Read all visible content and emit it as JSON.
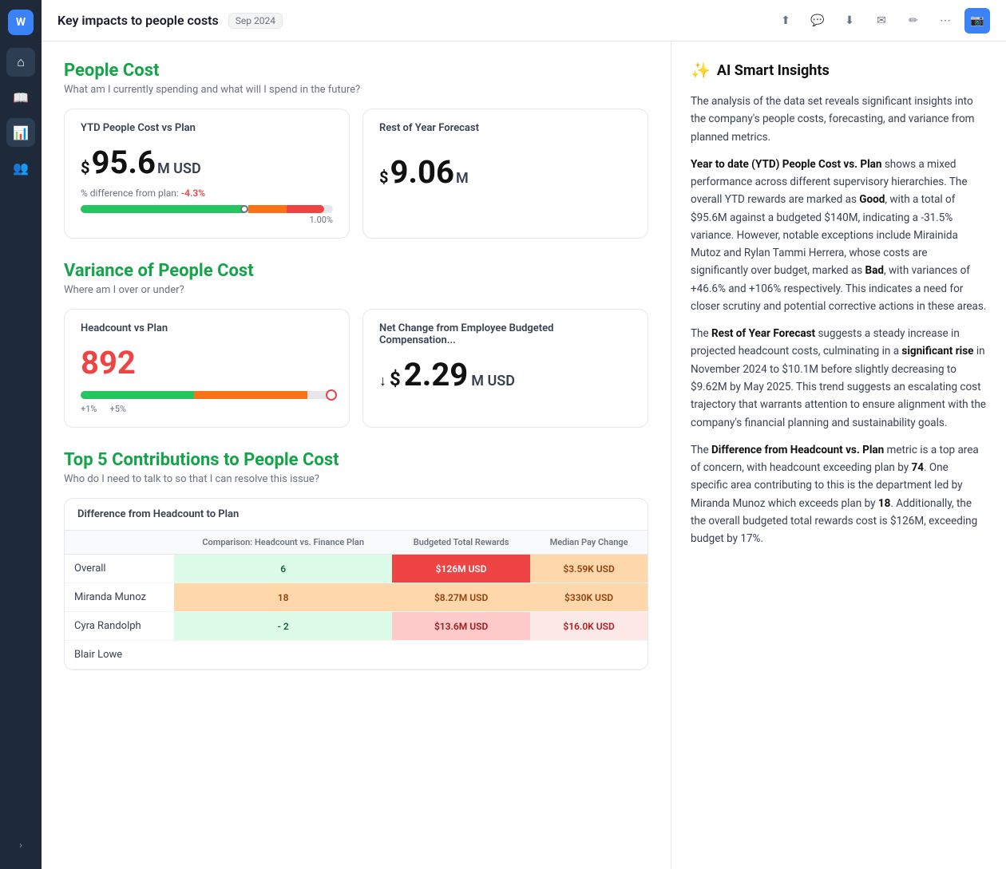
{
  "sidebar": {
    "logo": "W",
    "items": [
      {
        "icon": "⌂",
        "label": "Home",
        "active": false
      },
      {
        "icon": "📖",
        "label": "Library",
        "active": false
      },
      {
        "icon": "📊",
        "label": "Analytics",
        "active": true
      },
      {
        "icon": "👥",
        "label": "People",
        "active": false
      }
    ],
    "collapse_label": "‹"
  },
  "topbar": {
    "title": "Key impacts to people costs",
    "badge": "Sep 2024",
    "actions": [
      {
        "icon": "⬆",
        "name": "upload-icon"
      },
      {
        "icon": "💬",
        "name": "comment-icon"
      },
      {
        "icon": "⬇",
        "name": "download-icon"
      },
      {
        "icon": "✉",
        "name": "email-icon"
      },
      {
        "icon": "✏",
        "name": "edit-icon"
      },
      {
        "icon": "⋯",
        "name": "more-icon"
      },
      {
        "icon": "📷",
        "name": "camera-icon",
        "active": true
      }
    ]
  },
  "people_cost": {
    "title": "People Cost",
    "subtitle": "What am I currently spending and what will I spend in the future?",
    "ytd_card": {
      "label": "YTD People Cost vs Plan",
      "dollar_prefix": "$",
      "value": "95.6",
      "suffix": "M USD",
      "diff_label": "% difference from plan:",
      "diff_value": "-4.3%",
      "progress_percent": "1.00%"
    },
    "forecast_card": {
      "label": "Rest of Year Forecast",
      "dollar_prefix": "$",
      "value": "9.06",
      "suffix": "M"
    }
  },
  "variance": {
    "title": "Variance of People Cost",
    "subtitle": "Where am I over or under?",
    "headcount_card": {
      "label": "Headcount vs Plan",
      "value": "892",
      "plus1": "+1%",
      "plus5": "+5%"
    },
    "net_change_card": {
      "label": "Net Change from Employee Budgeted Compensation...",
      "dollar_prefix": "$",
      "value": "2.29",
      "suffix": "M USD"
    }
  },
  "top5": {
    "title": "Top 5 Contributions to People Cost",
    "subtitle": "Who do I need to talk to so that I can resolve this issue?",
    "table": {
      "header": "Difference from Headcount to Plan",
      "columns": [
        "",
        "Comparison: Headcount vs. Finance Plan",
        "Budgeted Total Rewards",
        "Median Pay Change"
      ],
      "rows": [
        {
          "name": "Overall",
          "comparison": "6",
          "budgeted": "$126M USD",
          "median": "$3.59K USD",
          "comp_class": "cell-green",
          "budgeted_class": "cell-red-strong",
          "median_class": "cell-orange"
        },
        {
          "name": "Miranda Munoz",
          "comparison": "18",
          "budgeted": "$8.27M USD",
          "median": "$330K USD",
          "comp_class": "cell-orange",
          "budgeted_class": "cell-orange",
          "median_class": "cell-orange"
        },
        {
          "name": "Cyra Randolph",
          "comparison": "- 2",
          "budgeted": "$13.6M USD",
          "median": "$16.0K USD",
          "comp_class": "cell-green",
          "budgeted_class": "cell-red-light",
          "median_class": "cell-pink"
        },
        {
          "name": "Blair Lowe",
          "comparison": "",
          "budgeted": "",
          "median": "",
          "comp_class": "",
          "budgeted_class": "",
          "median_class": ""
        }
      ]
    }
  },
  "ai_insights": {
    "title": "AI Smart Insights",
    "star": "✨",
    "paragraphs": [
      "The analysis of the data set reveals significant insights into the company's people costs, forecasting, and variance from planned metrics.",
      "Year to date (YTD) People Cost vs. Plan shows a mixed performance across different supervisory hierarchies. The overall YTD rewards are marked as Good, with a total of $95.6M against a budgeted $140M, indicating a -31.5% variance. However, notable exceptions include Mirainida Mutoz and Rylan Tammi Herrera, whose costs are significantly over budget, marked as Bad, with variances of +46.6% and +106% respectively. This indicates a need for closer scrutiny and potential corrective actions in these areas.",
      "The Rest of Year Forecast suggests a steady increase in projected headcount costs, culminating in a significant rise in November 2024 to $10.1M before slightly decreasing to $9.62M by May 2025. This trend suggests an escalating cost trajectory that warrants attention to ensure alignment with the company's financial planning and sustainability goals.",
      "The Difference from Headcount vs. Plan metric is a top area of concern, with headcount exceeding plan by 74. One specific area contributing to this is the department led by Miranda Munoz which exceeds plan by 18. Additionally, the the overall budgeted total rewards cost is $126M, exceeding budget by 17%."
    ],
    "bold_phrases": {
      "p2_bold": [
        "Year to date (YTD) People Cost vs. Plan",
        "Good",
        "Bad"
      ],
      "p3_bold": [
        "Rest of Year Forecast",
        "significant rise"
      ],
      "p4_bold": [
        "Difference from Headcount vs. Plan",
        "74",
        "18"
      ]
    }
  }
}
